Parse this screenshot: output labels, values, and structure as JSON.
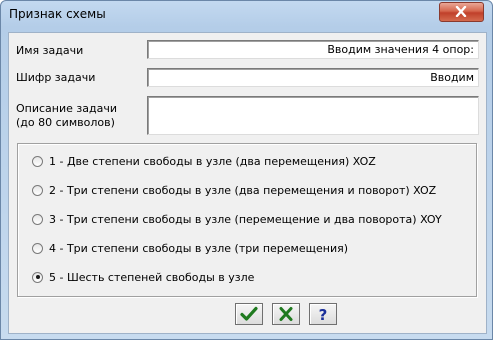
{
  "window": {
    "title": "Признак схемы"
  },
  "form": {
    "task_name": {
      "label": "Имя задачи",
      "value": "Вводим значения 4 опор:"
    },
    "task_code": {
      "label": "Шифр задачи",
      "value": "Вводим"
    },
    "task_desc": {
      "label_line1": "Описание задачи",
      "label_line2": "(до 80 символов)",
      "value": ""
    }
  },
  "scheme_options": [
    {
      "label": "1 - Две степени свободы в узле (два перемещения) XOZ",
      "selected": false
    },
    {
      "label": "2 - Три степени свободы в узле (два перемещения и поворот) XOZ",
      "selected": false
    },
    {
      "label": "3 - Три степени свободы в узле (перемещение и два поворота) XOY",
      "selected": false
    },
    {
      "label": "4 - Три степени свободы в узле (три перемещения)",
      "selected": false
    },
    {
      "label": "5 - Шесть степеней свободы в узле",
      "selected": true
    }
  ],
  "buttons": {
    "ok_icon": "checkmark-icon",
    "cancel_icon": "cross-icon",
    "help_icon": "question-icon",
    "help_glyph": "?"
  },
  "colors": {
    "ok": "#1f7a1f",
    "cancel": "#1f7a1f",
    "help": "#1a2f9a"
  }
}
